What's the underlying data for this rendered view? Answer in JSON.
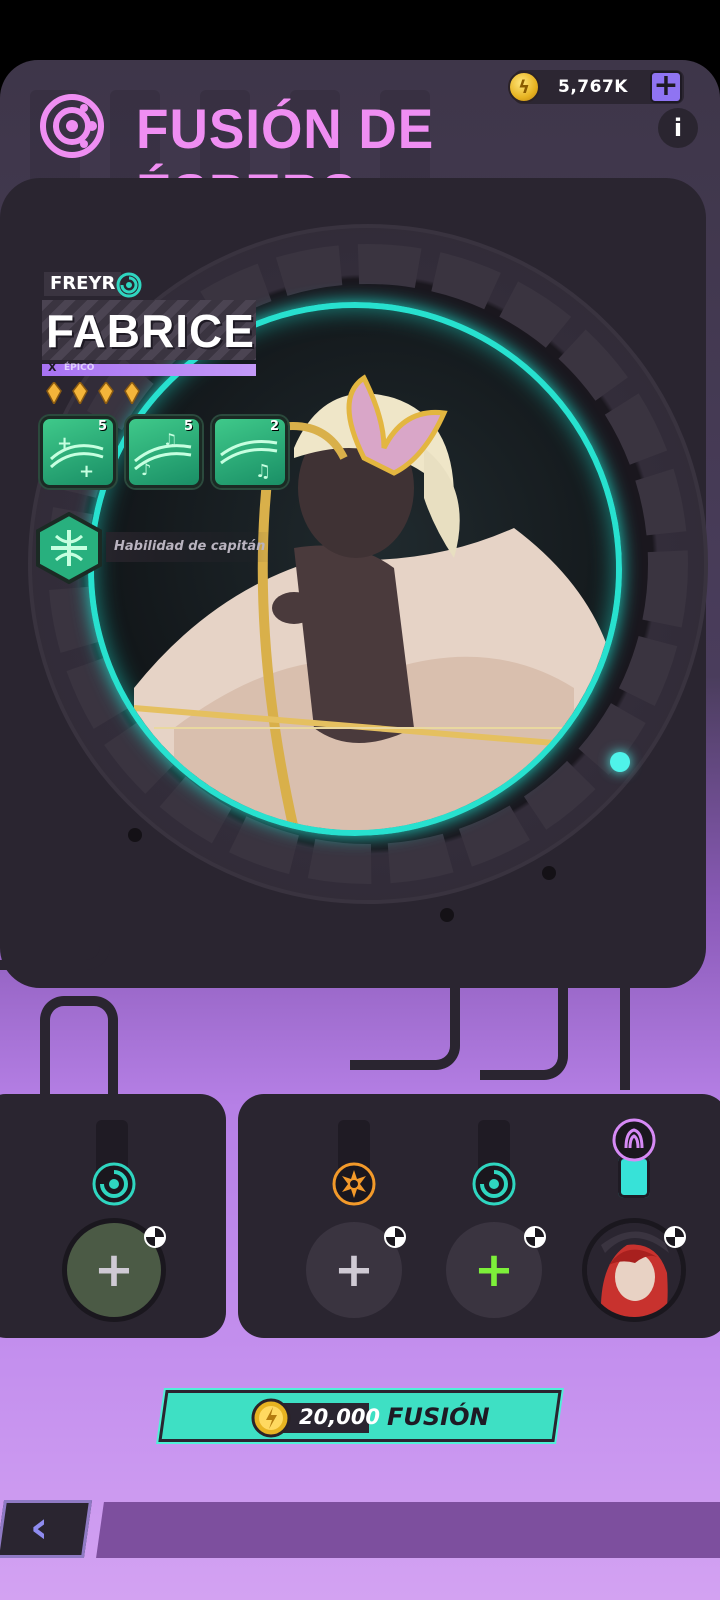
{
  "topbar": {
    "currency_amount": "5,767K",
    "add_label": "+"
  },
  "title": "FUSIÓN DE ÉSPERS",
  "info_label": "i",
  "character": {
    "subtitle": "FREYR",
    "name": "FABRICE",
    "rarity": "ÉPICO",
    "rarity_mark": "X",
    "star_count": 4,
    "skills": [
      {
        "level": "5"
      },
      {
        "level": "5"
      },
      {
        "level": "2"
      }
    ],
    "captain_skill_label": "Habilidad de capitán"
  },
  "colors": {
    "accent_title": "#ef8ef2",
    "portrait_ring": "#27e1cf",
    "fuse_button": "#3ee0c4",
    "panel_dark": "#2a2530"
  },
  "slots": [
    {
      "element": "wind-icon",
      "content": "+"
    },
    {
      "element": "sun-icon",
      "content": "+"
    },
    {
      "element": "wind-icon",
      "content": "+"
    },
    {
      "element": "water-icon",
      "content": "portrait"
    }
  ],
  "fuse": {
    "cost": "20,000",
    "label": "FUSIÓN"
  },
  "back_label": "‹"
}
